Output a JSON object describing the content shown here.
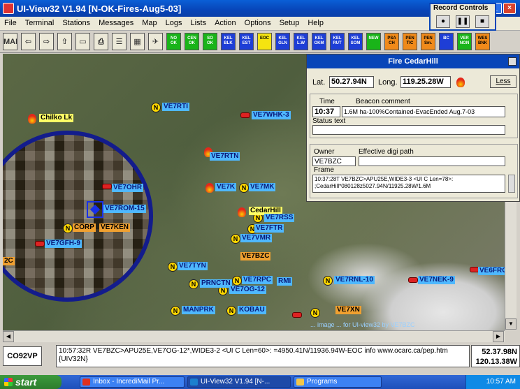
{
  "window": {
    "title": "UI-View32 V1.94 [N-OK-Fires-Aug5-03]"
  },
  "menu": [
    "File",
    "Terminal",
    "Stations",
    "Messages",
    "Map",
    "Logs",
    "Lists",
    "Action",
    "Options",
    "Setup",
    "Help"
  ],
  "toolbar": {
    "buttons": [
      {
        "label": "MAP",
        "color": "ic"
      },
      {
        "label": "⇦",
        "color": "ic"
      },
      {
        "label": "⇨",
        "color": "ic"
      },
      {
        "label": "⇧",
        "color": "ic"
      },
      {
        "label": "▭",
        "color": "ic"
      },
      {
        "label": "⎙",
        "color": "ic"
      },
      {
        "label": "☰",
        "color": "ic"
      },
      {
        "label": "▦",
        "color": "ic"
      },
      {
        "label": "✈",
        "color": "ic"
      },
      {
        "label": "NO OK",
        "color": "g"
      },
      {
        "label": "CEN OK",
        "color": "g"
      },
      {
        "label": "SO OK",
        "color": "g"
      },
      {
        "label": "KEL BLK",
        "color": "b"
      },
      {
        "label": "KEL EST",
        "color": "b"
      },
      {
        "label": "EOC",
        "color": "y"
      },
      {
        "label": "KEL GLN",
        "color": "b"
      },
      {
        "label": "KEL L.W",
        "color": "b"
      },
      {
        "label": "KEL OKM",
        "color": "b"
      },
      {
        "label": "KEL RUT",
        "color": "b"
      },
      {
        "label": "KEL SOM",
        "color": "b"
      },
      {
        "label": "NEW",
        "color": "g"
      },
      {
        "label": "PSA CH",
        "color": "o"
      },
      {
        "label": "PEN TIC",
        "color": "o"
      },
      {
        "label": "PEN Sm.",
        "color": "o"
      },
      {
        "label": "BC",
        "color": "b"
      },
      {
        "label": "VER NON",
        "color": "g"
      },
      {
        "label": "WES BNK",
        "color": "o"
      }
    ]
  },
  "record_controls": {
    "title": "Record Controls"
  },
  "map": {
    "stations": [
      {
        "label": "Chilko Lk",
        "style": "y"
      },
      {
        "label": "VE7RTI",
        "style": "b"
      },
      {
        "label": "VE7WHK-3",
        "style": "b"
      },
      {
        "label": "VE7RTN",
        "style": "b"
      },
      {
        "label": "VE7OHR",
        "style": "b"
      },
      {
        "label": "VE7K",
        "style": "b"
      },
      {
        "label": "VE7MK",
        "style": "b"
      },
      {
        "label": "VE7ROM-15",
        "style": "b"
      },
      {
        "label": "CedarHill",
        "style": "y"
      },
      {
        "label": "VE7RSS",
        "style": "b"
      },
      {
        "label": "CORP",
        "style": "o"
      },
      {
        "label": "VE7KEN",
        "style": "o"
      },
      {
        "label": "VE7FTR",
        "style": "b"
      },
      {
        "label": "VE7VMR",
        "style": "b"
      },
      {
        "label": "VE7GFH-9",
        "style": "b"
      },
      {
        "label": "VE7BZC",
        "style": "o"
      },
      {
        "label": "VE7TYN",
        "style": "b"
      },
      {
        "label": "VE7RPC",
        "style": "b"
      },
      {
        "label": "VE7RNL-10",
        "style": "b"
      },
      {
        "label": "VE7NEK-9",
        "style": "b"
      },
      {
        "label": "VE6FRC",
        "style": "b"
      },
      {
        "label": "PRNCTN",
        "style": "b"
      },
      {
        "label": "VE7OG-12",
        "style": "b"
      },
      {
        "label": "RMI",
        "style": "b"
      },
      {
        "label": "MANPRK",
        "style": "b"
      },
      {
        "label": "KOBAU",
        "style": "b"
      },
      {
        "label": "VE7XN",
        "style": "o"
      },
      {
        "label": "2C",
        "style": "o"
      }
    ],
    "credit": "... image ... for UI-view32 by VE7BZC"
  },
  "fire_popup": {
    "title": "Fire  CedarHill",
    "lat_label": "Lat.",
    "lat": "50.27.94N",
    "long_label": "Long.",
    "long": "119.25.28W",
    "less_button": "Less",
    "time_label": "Time",
    "time": "10:37",
    "beacon_label": "Beacon comment",
    "beacon": "1.6M ha-100%Contained-EvacEnded Aug.7-03",
    "status_label": "Status text",
    "status": "",
    "owner_label": "Owner",
    "owner": "VE7BZC",
    "digi_label": "Effective digi path",
    "digi": "",
    "frame_label": "Frame",
    "frame": "10:37:28T VE7BZC>APU25E,WIDE3-3 <UI C Len=78>: ;CedarHill*080128z5027.94N/11925.28W/1.6M"
  },
  "status": {
    "grid": "CO92VP",
    "packet": "10:57:32R VE7BZC>APU25E,VE7OG-12*,WIDE3-2 <UI C Len=60>: =4950.41N/11936.94W-EOC info  www.ocarc.ca/pep.htm {UIV32N}",
    "lat": "52.37.98N",
    "long": "120.13.38W"
  },
  "taskbar": {
    "start": "start",
    "tasks": [
      "Inbox - IncrediMail Pr...",
      "UI-View32 V1.94 [N-...",
      "Programs"
    ],
    "clock": "10:57 AM"
  }
}
